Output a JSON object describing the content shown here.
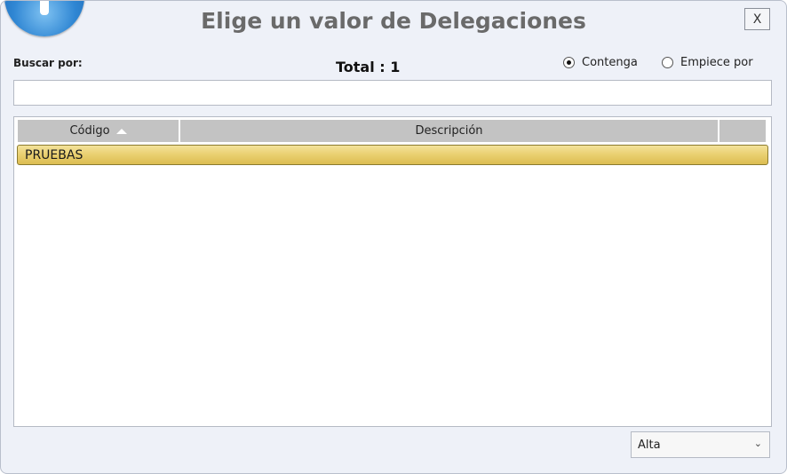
{
  "dialog": {
    "title": "Elige un valor de Delegaciones",
    "close_label": "X"
  },
  "search": {
    "label": "Buscar por:",
    "value": "",
    "placeholder": ""
  },
  "total_text": "Total : 1",
  "match_mode": {
    "options": [
      {
        "label": "Contenga",
        "checked": true
      },
      {
        "label": "Empiece por",
        "checked": false
      }
    ]
  },
  "grid": {
    "columns": [
      "Código",
      "Descripción",
      ""
    ],
    "sorted_column": "Código",
    "sort_direction": "ascending",
    "rows": [
      {
        "codigo": "PRUEBAS",
        "descripcion": "",
        "selected": true
      }
    ],
    "selected_row_color": "#e9cf6f"
  },
  "footer": {
    "select_value": "Alta"
  },
  "icons": {
    "app": "info-icon",
    "sort": "sort-ascending-icon",
    "dropdown": "chevron-down-icon"
  }
}
